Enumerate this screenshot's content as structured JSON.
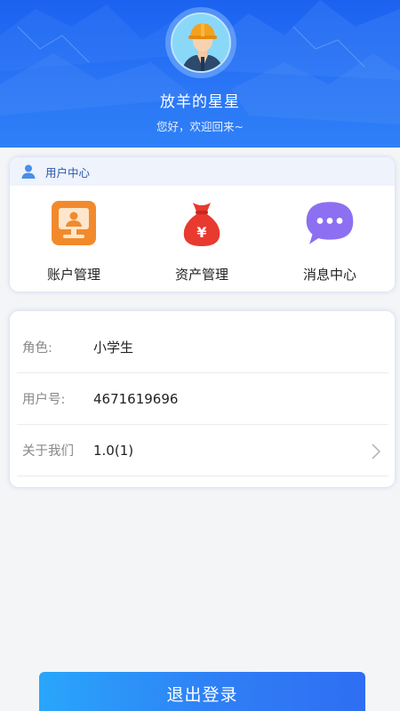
{
  "profile": {
    "name": "放羊的星星",
    "greeting": "您好，欢迎回来~",
    "avatar_icon": "worker-helmet-avatar"
  },
  "user_center": {
    "title": "用户中心",
    "title_icon": "user-icon",
    "items": [
      {
        "label": "账户管理",
        "icon": "monitor-account-icon",
        "color": "#f28a2c"
      },
      {
        "label": "资产管理",
        "icon": "money-bag-icon",
        "color": "#e83a2f"
      },
      {
        "label": "消息中心",
        "icon": "chat-bubble-icon",
        "color": "#8d6ff2"
      }
    ]
  },
  "info": {
    "rows": [
      {
        "key": "角色:",
        "value": "小学生"
      },
      {
        "key": "用户号:",
        "value": "4671619696"
      },
      {
        "key": "关于我们",
        "value": "1.0(1)"
      }
    ]
  },
  "logout_label": "退出登录",
  "colors": {
    "header": "#1b62f0",
    "accent": "#2f7ff5",
    "page_bg": "#f4f5f7"
  }
}
